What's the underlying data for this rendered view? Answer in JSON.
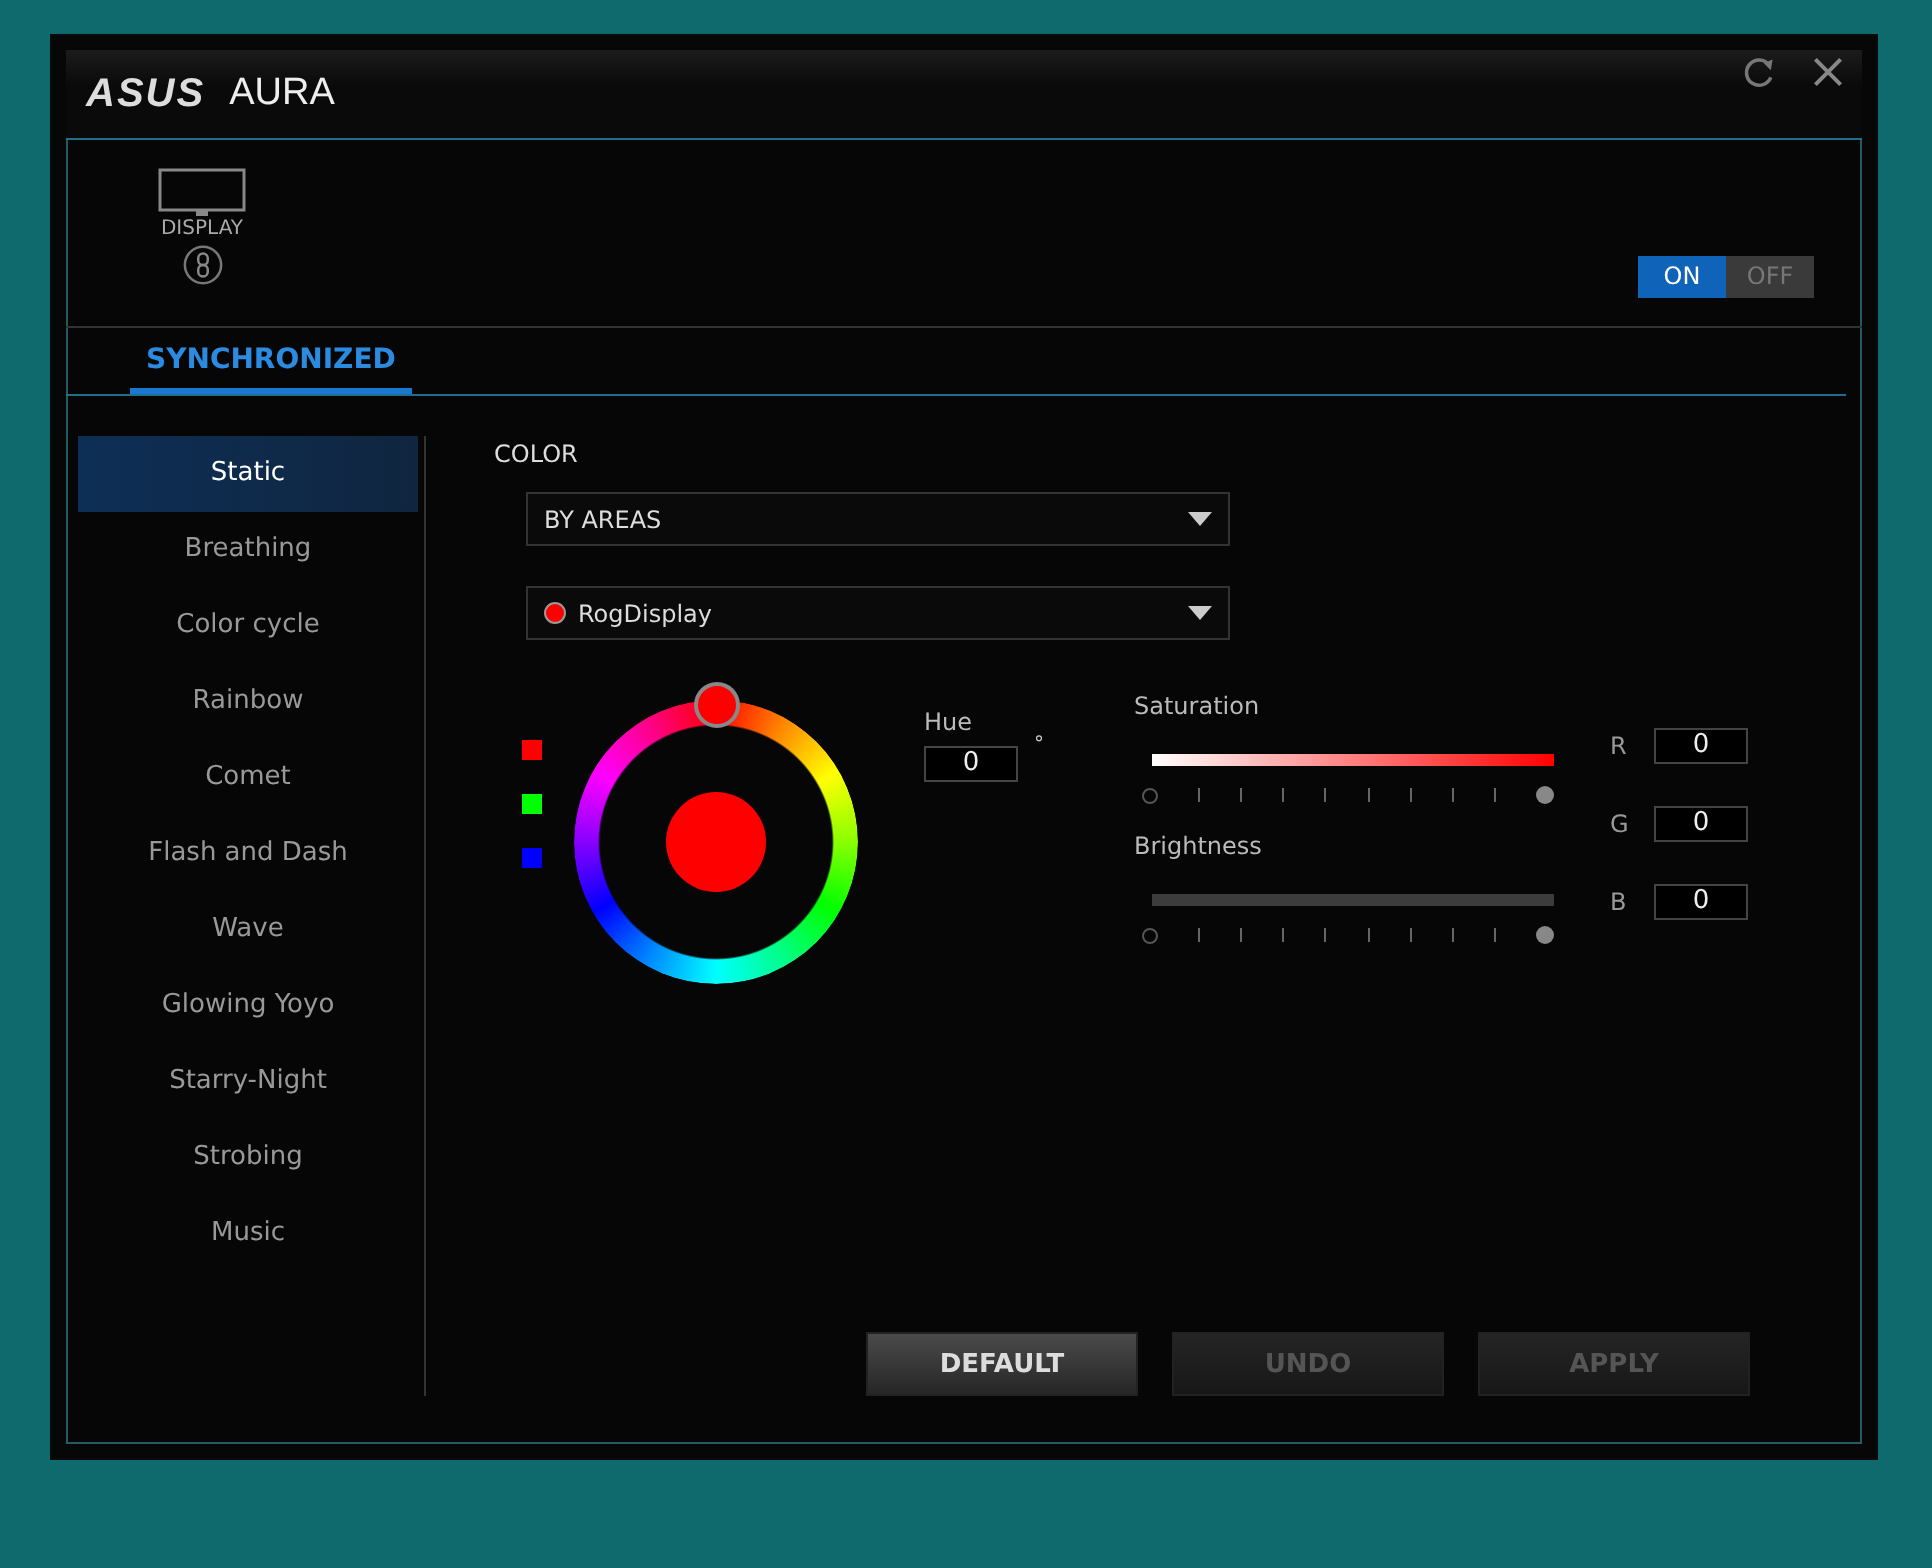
{
  "window": {
    "logo": "ASUS",
    "title": "AURA"
  },
  "device": {
    "label": "DISPLAY"
  },
  "power": [
    {
      "label": "ON",
      "selected": true
    },
    {
      "label": "OFF",
      "selected": false
    }
  ],
  "tab": {
    "label": "SYNCHRONIZED",
    "selected": true
  },
  "effects": [
    {
      "label": "Static",
      "selected": true
    },
    {
      "label": "Breathing",
      "selected": false
    },
    {
      "label": "Color cycle",
      "selected": false
    },
    {
      "label": "Rainbow",
      "selected": false
    },
    {
      "label": "Comet",
      "selected": false
    },
    {
      "label": "Flash and Dash",
      "selected": false
    },
    {
      "label": "Wave",
      "selected": false
    },
    {
      "label": "Glowing Yoyo",
      "selected": false
    },
    {
      "label": "Starry-Night",
      "selected": false
    },
    {
      "label": "Strobing",
      "selected": false
    },
    {
      "label": "Music",
      "selected": false
    }
  ],
  "color": {
    "heading": "COLOR",
    "mode_dropdown": "BY AREAS",
    "area_dropdown": {
      "label": "RogDisplay",
      "color": "#ff0000"
    },
    "swatches": [
      {
        "color": "#ff0000"
      },
      {
        "color": "#00ff00"
      },
      {
        "color": "#0000ff"
      }
    ],
    "preview": {
      "color": "#ff0000"
    },
    "hue": {
      "label": "Hue",
      "value": "0",
      "unit": "°"
    },
    "saturation": {
      "label": "Saturation",
      "level": 1
    },
    "brightness": {
      "label": "Brightness",
      "level": 1
    },
    "rgb": [
      {
        "label": "R",
        "value": "0"
      },
      {
        "label": "G",
        "value": "0"
      },
      {
        "label": "B",
        "value": "0"
      }
    ]
  },
  "buttons": [
    {
      "label": "DEFAULT",
      "disabled": false
    },
    {
      "label": "UNDO",
      "disabled": true
    },
    {
      "label": "APPLY",
      "disabled": true
    }
  ]
}
